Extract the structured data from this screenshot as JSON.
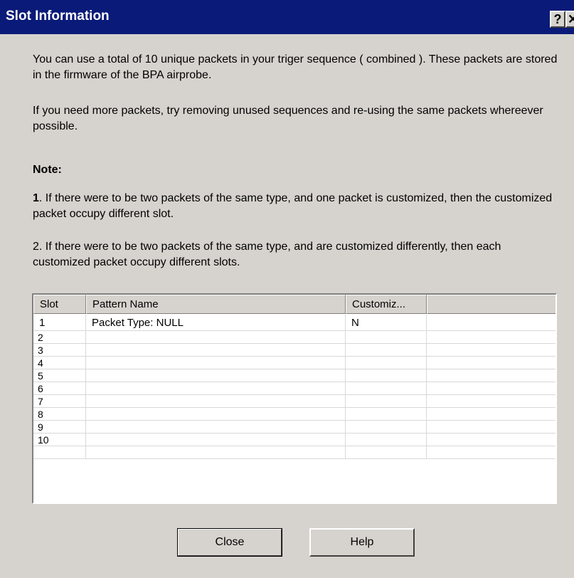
{
  "window": {
    "title": "Slot Information",
    "help_glyph": "?",
    "close_glyph": "✕"
  },
  "intro": {
    "para1": "You can use a total of 10 unique packets in your triger sequence ( combined ). These packets are stored in the firmware of the BPA airprobe.",
    "para2": "If you need more packets, try removing unused sequences and re-using the same packets whereever possible."
  },
  "notes": {
    "heading": "Note:",
    "note1_num": "1",
    "note1_text": ". If there were to be two packets of the same type, and one packet is customized, then the customized packet occupy different slot.",
    "note2_text": "2. If there were to be two packets of the same type, and are customized differently, then each customized packet occupy different slots."
  },
  "table": {
    "columns": [
      "Slot",
      "Pattern Name",
      "Customiz...",
      ""
    ],
    "rows": [
      [
        "1",
        "Packet Type: NULL",
        "N",
        ""
      ],
      [
        "2",
        "",
        "",
        ""
      ],
      [
        "3",
        "",
        "",
        ""
      ],
      [
        "4",
        "",
        "",
        ""
      ],
      [
        "5",
        "",
        "",
        ""
      ],
      [
        "6",
        "",
        "",
        ""
      ],
      [
        "7",
        "",
        "",
        ""
      ],
      [
        "8",
        "",
        "",
        ""
      ],
      [
        "9",
        "",
        "",
        ""
      ],
      [
        "10",
        "",
        "",
        ""
      ],
      [
        "",
        "",
        "",
        ""
      ]
    ]
  },
  "buttons": {
    "close": "Close",
    "help": "Help"
  },
  "colors": {
    "title_bar": "#0a1a78",
    "dialog_bg": "#d6d3ce"
  }
}
